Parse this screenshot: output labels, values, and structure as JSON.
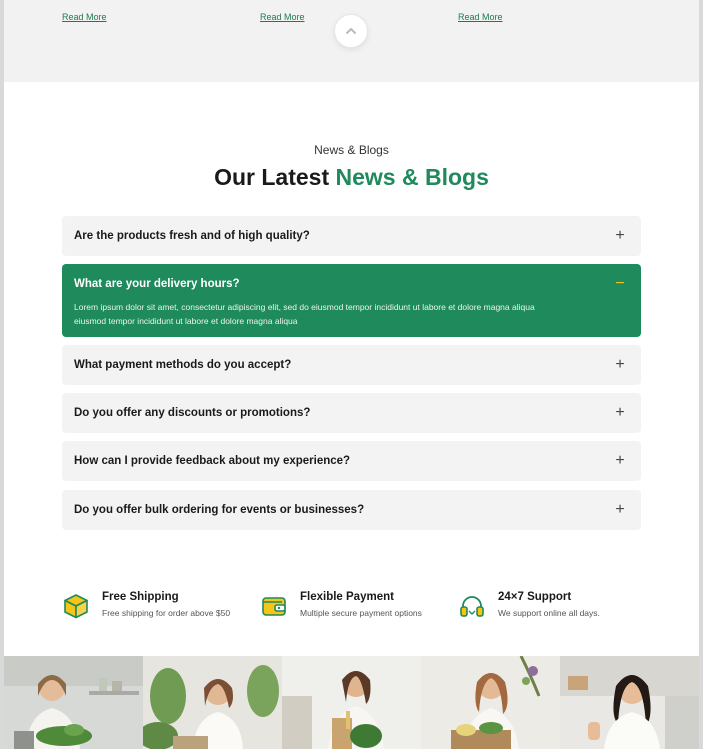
{
  "prev_blog": {
    "read_more_labels": [
      "Read More",
      "Read More",
      "Read More"
    ]
  },
  "section": {
    "eyebrow": "News & Blogs",
    "title_plain": "Our Latest ",
    "title_accent": "News & Blogs"
  },
  "faq": [
    {
      "question": "Are the products fresh and of high quality?",
      "open": false,
      "toggle": "+"
    },
    {
      "question": "What are your delivery hours?",
      "open": true,
      "toggle": "−",
      "answer": "Lorem ipsum dolor sit amet, consectetur adipiscing elit, sed do eiusmod tempor incididunt ut labore et dolore magna aliqua eiusmod tempor incididunt ut labore et dolore magna aliqua"
    },
    {
      "question": "What payment methods do you accept?",
      "open": false,
      "toggle": "+"
    },
    {
      "question": "Do you offer any discounts or promotions?",
      "open": false,
      "toggle": "+"
    },
    {
      "question": "How can I provide feedback about my experience?",
      "open": false,
      "toggle": "+"
    },
    {
      "question": "Do you offer bulk ordering for events or businesses?",
      "open": false,
      "toggle": "+"
    }
  ],
  "features": [
    {
      "icon": "box-icon",
      "title": "Free Shipping",
      "subtitle": "Free shipping for order above $50"
    },
    {
      "icon": "wallet-icon",
      "title": "Flexible Payment",
      "subtitle": "Multiple secure payment options"
    },
    {
      "icon": "headset-icon",
      "title": "24×7 Support",
      "subtitle": "We support online all days."
    }
  ],
  "gallery": {
    "photos": [
      "woman-with-vegetables-photo",
      "woman-with-plants-photo",
      "woman-holding-groceries-photo",
      "woman-with-produce-box-photo",
      "woman-thumbs-up-photo"
    ]
  },
  "colors": {
    "brand_green": "#1f8a5b",
    "accent_yellow": "#f5c518",
    "band_grey": "#f2f2f2",
    "card_grey": "#f3f3f3"
  }
}
